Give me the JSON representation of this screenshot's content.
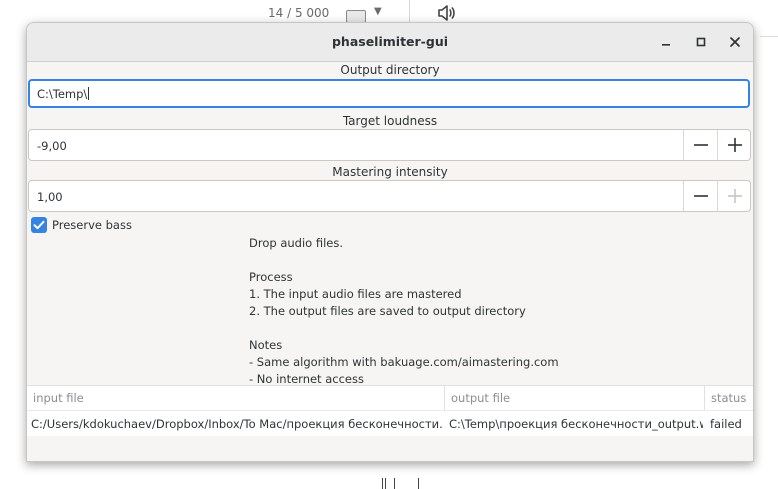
{
  "background": {
    "counter": "14 / 5 000",
    "keyboard_icon": "keyboard-icon",
    "caret_icon": "chevron-down-icon",
    "speaker_icon": "speaker-icon"
  },
  "window": {
    "title": "phaselimiter-gui",
    "controls": [
      "minimize-icon",
      "maximize-icon",
      "close-icon"
    ]
  },
  "output_directory": {
    "label": "Output directory",
    "value": "C:\\Temp\\"
  },
  "target_loudness": {
    "label": "Target loudness",
    "value": "-9,00"
  },
  "mastering_intensity": {
    "label": "Mastering intensity",
    "value": "1,00"
  },
  "preserve_bass": {
    "label": "Preserve bass",
    "checked": true
  },
  "instructions": [
    "Drop audio files.",
    "",
    "Process",
    "1. The input audio files are mastered",
    "2. The output files are saved to output directory",
    "",
    "Notes",
    "- Same algorithm with bakuage.com/aimastering.com",
    "- No internet access"
  ],
  "table": {
    "headers": [
      "input file",
      "output file",
      "status"
    ],
    "rows": [
      [
        "C:/Users/kdokuchaev/Dropbox/Inbox/To Mac/проекция бесконечности.wav",
        "C:\\Temp\\проекция бесконечности_output.wav",
        "failed"
      ]
    ]
  },
  "colors": {
    "accent": "#3584e4",
    "window_bg": "#f6f5f4",
    "titlebar_bg": "#ebebeb"
  }
}
